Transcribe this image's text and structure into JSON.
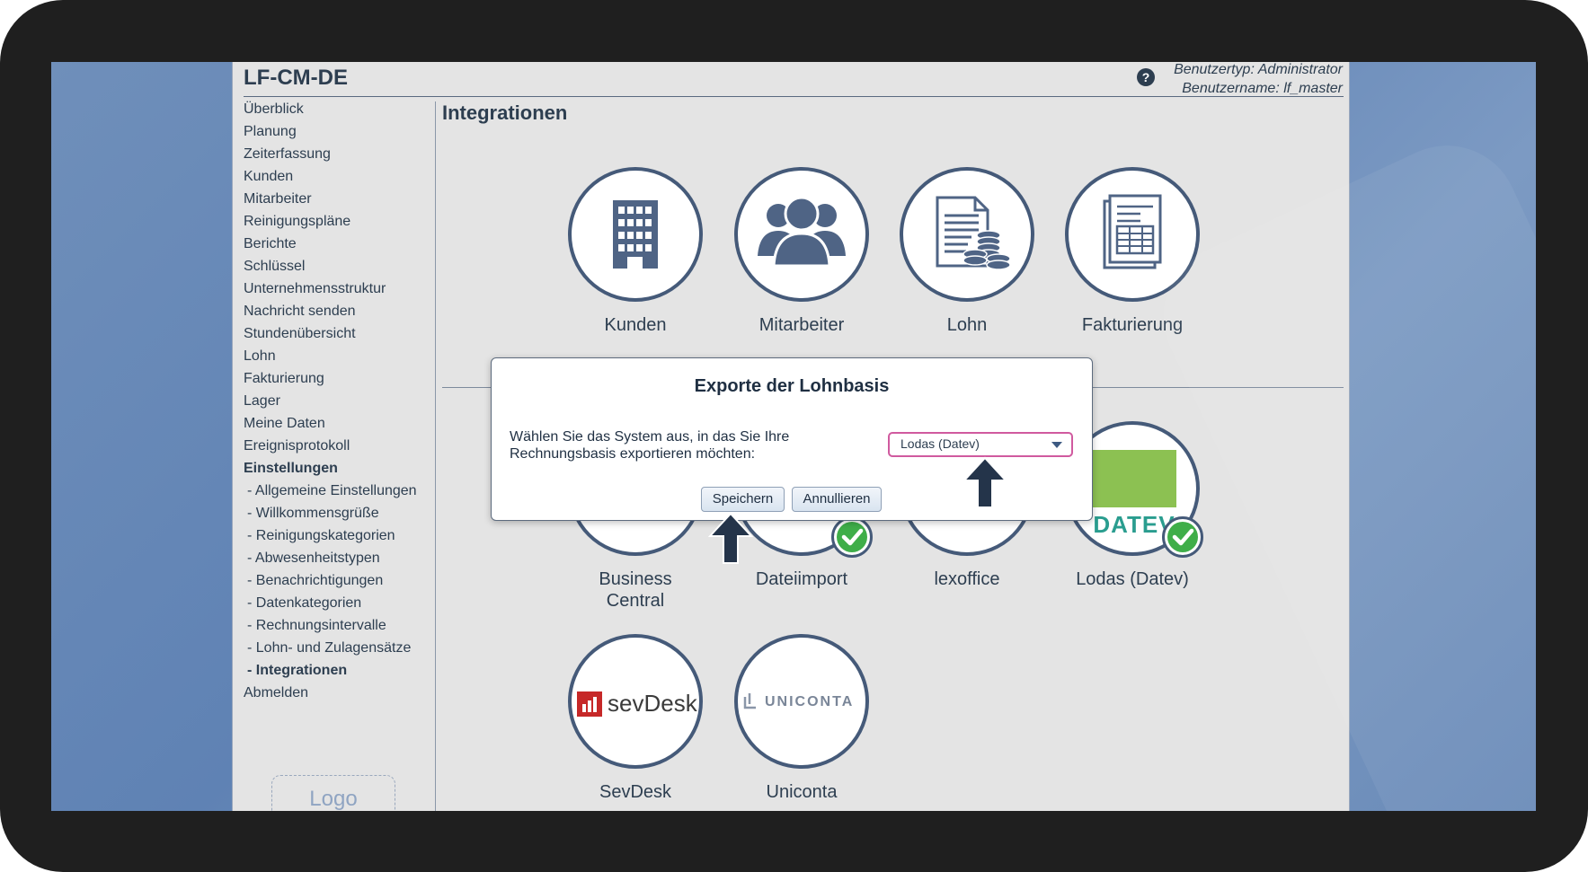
{
  "app": {
    "title": "LF-CM-DE",
    "user_type": "Benutzertyp: Administrator",
    "user_name": "Benutzername: lf_master",
    "help_glyph": "?"
  },
  "sidebar": {
    "items": [
      {
        "label": "Überblick"
      },
      {
        "label": "Planung"
      },
      {
        "label": "Zeiterfassung"
      },
      {
        "label": "Kunden"
      },
      {
        "label": "Mitarbeiter"
      },
      {
        "label": "Reinigungspläne"
      },
      {
        "label": "Berichte"
      },
      {
        "label": "Schlüssel"
      },
      {
        "label": "Unternehmensstruktur"
      },
      {
        "label": "Nachricht senden"
      },
      {
        "label": "Stundenübersicht"
      },
      {
        "label": "Lohn"
      },
      {
        "label": "Fakturierung"
      },
      {
        "label": "Lager"
      },
      {
        "label": "Meine Daten"
      },
      {
        "label": "Ereignisprotokoll"
      },
      {
        "label": "Einstellungen"
      },
      {
        "label": " - Allgemeine Einstellungen"
      },
      {
        "label": " - Willkommensgrüße"
      },
      {
        "label": " - Reinigungskategorien"
      },
      {
        "label": " - Abwesenheitstypen"
      },
      {
        "label": " - Benachrichtigungen"
      },
      {
        "label": " - Datenkategorien"
      },
      {
        "label": " - Rechnungsintervalle"
      },
      {
        "label": " - Lohn- und Zulagensätze"
      },
      {
        "label": " - Integrationen"
      },
      {
        "label": "Abmelden"
      }
    ],
    "logo_text": "Logo"
  },
  "content": {
    "title": "Integrationen",
    "top_tiles": [
      {
        "label": "Kunden",
        "icon": "building-icon"
      },
      {
        "label": "Mitarbeiter",
        "icon": "people-icon"
      },
      {
        "label": "Lohn",
        "icon": "payroll-icon"
      },
      {
        "label": "Fakturierung",
        "icon": "invoice-icon"
      }
    ],
    "bottom_tiles": [
      {
        "label": "Business\nCentral"
      },
      {
        "label": "Dateiimport"
      },
      {
        "label": "lexoffice"
      },
      {
        "label": "Lodas (Datev)"
      },
      {
        "label": "SevDesk"
      },
      {
        "label": "Uniconta"
      }
    ],
    "logos": {
      "datev": "DATEV",
      "sevdesk": "sevDesk",
      "uniconta": "UNICONTA"
    }
  },
  "dialog": {
    "title": "Exporte der Lohnbasis",
    "text": "Wählen Sie das System aus, in das Sie Ihre Rechnungsbasis exportieren möchten:",
    "selected_option": "Lodas (Datev)",
    "save_label": "Speichern",
    "cancel_label": "Annullieren"
  },
  "colors": {
    "accent": "#455a79",
    "check_green": "#3fae49",
    "select_border": "#d05a9f",
    "arrow": "#24344a"
  }
}
